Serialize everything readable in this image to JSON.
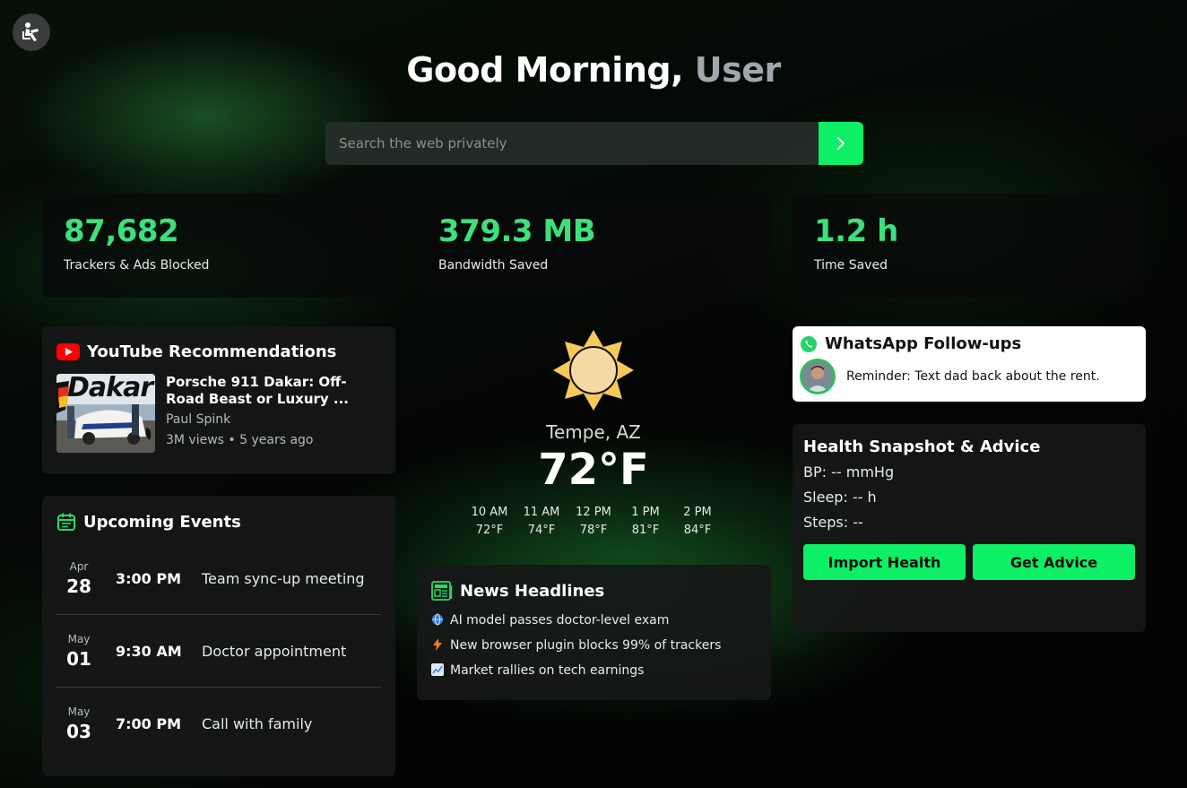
{
  "colors": {
    "accent": "#0df065",
    "stat_green": "#3ce07c",
    "muted_user": "#a0a7ad"
  },
  "header": {
    "greeting": "Good Morning,",
    "user": "User"
  },
  "search": {
    "placeholder": "Search the web privately",
    "button_icon": "chevron-right-icon"
  },
  "stats": [
    {
      "value": "87,682",
      "label": "Trackers & Ads Blocked"
    },
    {
      "value": "379.3 MB",
      "label": "Bandwidth Saved"
    },
    {
      "value": "1.2 h",
      "label": "Time Saved"
    }
  ],
  "youtube": {
    "title": "YouTube Recommendations",
    "video": {
      "title": "Porsche 911 Dakar: Off-Road Beast or Luxury ...",
      "channel": "Paul Spink",
      "meta": "3M views • 5 years ago",
      "thumb_text": "Dakar"
    }
  },
  "events": {
    "title": "Upcoming Events",
    "items": [
      {
        "month": "Apr",
        "day": "28",
        "time": "3:00 PM",
        "title": "Team sync-up meeting"
      },
      {
        "month": "May",
        "day": "01",
        "time": "9:30 AM",
        "title": "Doctor appointment"
      },
      {
        "month": "May",
        "day": "03",
        "time": "7:00 PM",
        "title": "Call with family"
      }
    ]
  },
  "weather": {
    "location": "Tempe, AZ",
    "temp": "72°F",
    "forecast": [
      {
        "time": "10 AM",
        "temp": "72°F"
      },
      {
        "time": "11 AM",
        "temp": "74°F"
      },
      {
        "time": "12 PM",
        "temp": "78°F"
      },
      {
        "time": "1 PM",
        "temp": "81°F"
      },
      {
        "time": "2 PM",
        "temp": "84°F"
      }
    ]
  },
  "news": {
    "title": "News Headlines",
    "items": [
      {
        "icon": "globe-icon",
        "text": "AI model passes doctor-level exam"
      },
      {
        "icon": "lightning-icon",
        "text": "New browser plugin blocks 99% of trackers"
      },
      {
        "icon": "chart-icon",
        "text": "Market rallies on tech earnings"
      }
    ]
  },
  "whatsapp": {
    "title": "WhatsApp Follow-ups",
    "message": "Reminder: Text dad back about the rent."
  },
  "health": {
    "title": "Health Snapshot & Advice",
    "bp": "BP: -- mmHg",
    "sleep": "Sleep: -- h",
    "steps": "Steps: --",
    "import_label": "Import Health",
    "advice_label": "Get Advice"
  }
}
